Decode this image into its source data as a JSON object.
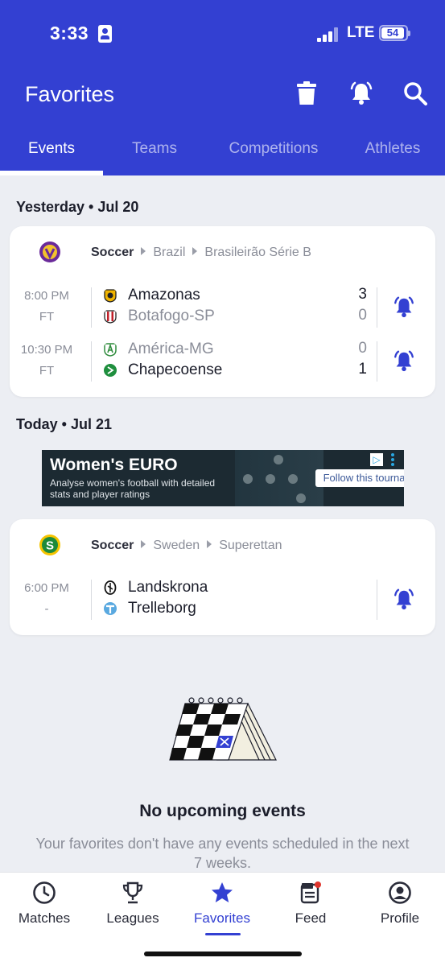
{
  "status_bar": {
    "time": "3:33",
    "network": "LTE",
    "battery": "54"
  },
  "header": {
    "title": "Favorites"
  },
  "tabs": [
    {
      "label": "Events",
      "active": true
    },
    {
      "label": "Teams",
      "active": false
    },
    {
      "label": "Competitions",
      "active": false
    },
    {
      "label": "Athletes",
      "active": false
    }
  ],
  "sections": [
    {
      "date_label": "Yesterday • Jul 20",
      "card": {
        "sport": "Soccer",
        "country": "Brazil",
        "league": "Brasileirão Série B",
        "matches": [
          {
            "time": "8:00 PM",
            "status": "FT",
            "home": "Amazonas",
            "away": "Botafogo-SP",
            "home_score": "3",
            "away_score": "0"
          },
          {
            "time": "10:30 PM",
            "status": "FT",
            "home": "América-MG",
            "away": "Chapecoense",
            "home_score": "0",
            "away_score": "1"
          }
        ]
      }
    },
    {
      "date_label": "Today • Jul 21",
      "card": {
        "sport": "Soccer",
        "country": "Sweden",
        "league": "Superettan",
        "matches": [
          {
            "time": "6:00 PM",
            "status": "-",
            "home": "Landskrona",
            "away": "Trelleborg"
          }
        ]
      }
    }
  ],
  "ad": {
    "headline": "Women's EURO",
    "subtext": "Analyse women's football with detailed stats and player ratings",
    "cta": "Follow this tournament"
  },
  "empty_state": {
    "title": "No upcoming events",
    "subtitle": "Your favorites don't have any events scheduled in the next 7 weeks."
  },
  "bottom_nav": [
    {
      "label": "Matches",
      "icon": "clock-icon"
    },
    {
      "label": "Leagues",
      "icon": "trophy-icon"
    },
    {
      "label": "Favorites",
      "icon": "star-icon",
      "active": true
    },
    {
      "label": "Feed",
      "icon": "feed-icon"
    },
    {
      "label": "Profile",
      "icon": "profile-icon"
    }
  ],
  "colors": {
    "brand": "#3340d2",
    "background": "#eceef3",
    "muted": "#8a8d98"
  }
}
